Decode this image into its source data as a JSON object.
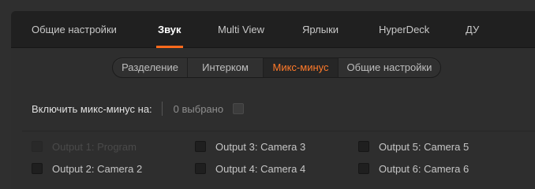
{
  "main_tabs": [
    {
      "label": "Общие настройки",
      "active": false
    },
    {
      "label": "Звук",
      "active": true
    },
    {
      "label": "Multi View",
      "active": false
    },
    {
      "label": "Ярлыки",
      "active": false
    },
    {
      "label": "HyperDeck",
      "active": false
    },
    {
      "label": "ДУ",
      "active": false
    }
  ],
  "sub_tabs": [
    {
      "label": "Разделение",
      "active": false
    },
    {
      "label": "Интерком",
      "active": false
    },
    {
      "label": "Микс-минус",
      "active": true
    },
    {
      "label": "Общие настройки",
      "active": false
    }
  ],
  "mix_minus": {
    "enable_label": "Включить микс-минус на:",
    "selected_count": "0 выбрано",
    "outputs": [
      {
        "label": "Output 1: Program",
        "checked": false,
        "enabled": false
      },
      {
        "label": "Output 2: Camera 2",
        "checked": false,
        "enabled": true
      },
      {
        "label": "Output 3: Camera 3",
        "checked": false,
        "enabled": true
      },
      {
        "label": "Output 4: Camera 4",
        "checked": false,
        "enabled": true
      },
      {
        "label": "Output 5: Camera 5",
        "checked": false,
        "enabled": true
      },
      {
        "label": "Output 6: Camera 6",
        "checked": false,
        "enabled": true
      }
    ]
  },
  "colors": {
    "accent": "#ff6a1c",
    "tab_bar": "#202020",
    "panel": "#2e2e2e"
  }
}
